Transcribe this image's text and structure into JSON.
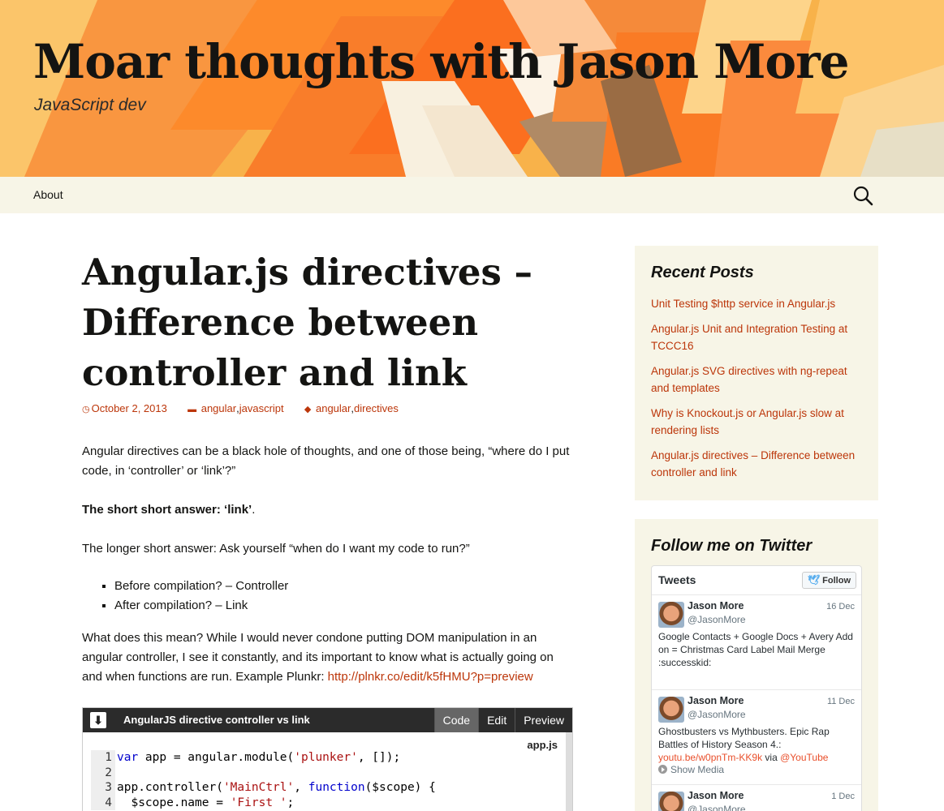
{
  "header": {
    "site_title": "Moar thoughts with Jason More",
    "site_description": "JavaScript dev"
  },
  "nav": {
    "items": [
      {
        "label": "About"
      }
    ],
    "search_icon": "search-icon"
  },
  "post": {
    "title": "Angular.js directives – Difference between controller and link",
    "date": "October 2, 2013",
    "categories": [
      "angular",
      "javascript"
    ],
    "tags": [
      "angular",
      "directives"
    ],
    "para1": "Angular directives can be a black hole of thoughts, and one of those being, “where do I put code, in ‘controller’ or ‘link’?”",
    "short_answer_label": "The short short answer: ‘link’",
    "short_answer_end": ".",
    "para3": "The longer short answer: Ask yourself “when do I want my code to run?”",
    "bullets": [
      "Before compilation? – Controller",
      "After compilation? – Link"
    ],
    "para4": "What does this mean? While I would never condone putting DOM manipulation in an angular controller, I see it constantly, and its important to know what is actually going on and when functions are run. Example Plunkr: ",
    "plunkr_link": "http://plnkr.co/edit/k5fHMU?p=preview"
  },
  "embed": {
    "title": "AngularJS directive controller vs link",
    "tabs": [
      "Code",
      "Edit",
      "Preview"
    ],
    "active_tab": "Code",
    "file": "app.js",
    "lines": [
      {
        "n": "1",
        "code": "var app = angular.module('plunker', []);"
      },
      {
        "n": "2",
        "code": ""
      },
      {
        "n": "3",
        "code": "app.controller('MainCtrl', function($scope) {"
      },
      {
        "n": "4",
        "code": "  $scope.name = 'First ';"
      }
    ]
  },
  "sidebar": {
    "recent_title": "Recent Posts",
    "recent_posts": [
      "Unit Testing $http service in Angular.js",
      "Angular.js Unit and Integration Testing at TCCC16",
      "Angular.js SVG directives with ng-repeat and templates",
      "Why is Knockout.js or Angular.js slow at rendering lists",
      "Angular.js directives – Difference between controller and link"
    ],
    "twitter_title": "Follow me on Twitter",
    "twitter": {
      "header": "Tweets",
      "follow": "Follow",
      "tweets": [
        {
          "name": "Jason More",
          "handle": "@JasonMore",
          "date": "16 Dec",
          "text": "Google Contacts + Google Docs + Avery Add on = Christmas Card Label Mail Merge :successkid:"
        },
        {
          "name": "Jason More",
          "handle": "@JasonMore",
          "date": "11 Dec",
          "text": "Ghostbusters vs Mythbusters.  Epic Rap Battles of History Season 4.:",
          "link": "youtu.be/w0pnTm-KK9k",
          "via": "via",
          "mention": "@YouTube",
          "media": "Show Media"
        },
        {
          "name": "Jason More",
          "handle": "@JasonMore",
          "date": "1 Dec"
        }
      ]
    }
  },
  "colors": {
    "accent": "#bc360a",
    "nav_bg": "#f7f5e7",
    "header_orange": "#f7a43a"
  }
}
